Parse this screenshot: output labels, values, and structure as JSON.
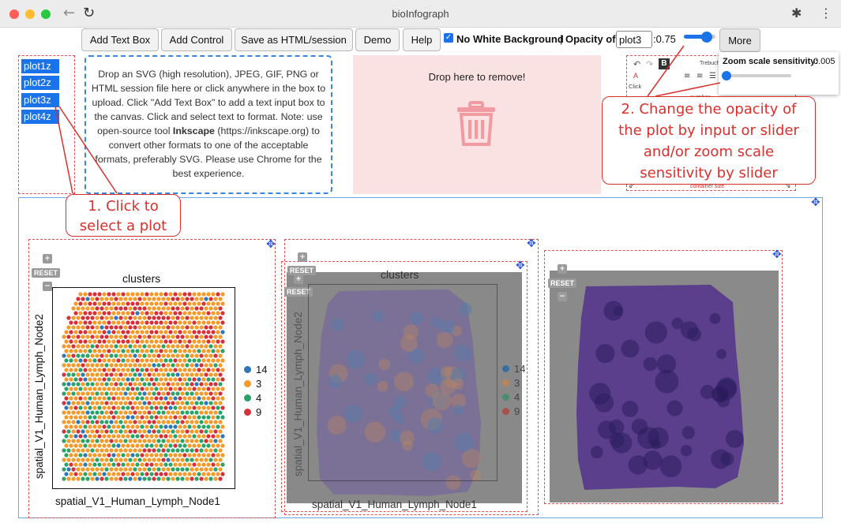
{
  "window": {
    "title": "bioInfograph"
  },
  "toolbar": {
    "buttons": [
      "Add Text Box",
      "Add Control",
      "Save as HTML/session",
      "Demo",
      "Help"
    ],
    "no_white_background_label": "No White Background",
    "separator": "|",
    "opacity_label": "Opacity of",
    "opacity_input_value": "plot3",
    "opacity_value": ":0.75",
    "opacity_fraction": 0.75,
    "more_label": "More"
  },
  "plot_list": [
    "plot1z",
    "plot2z",
    "plot3z",
    "plot4z"
  ],
  "dropzone": {
    "line1": "Drop an SVG (high resolution), JPEG, GIF, PNG or HTML session file here or click anywhere in the box to upload. Click \"Add Text Box\" to add a text input box to the canvas. Click and select text to format. Note: use open-source tool ",
    "tool_name": "Inkscape",
    "line2": " (https://inkscape.org) to convert other formats to one of the acceptable formats, preferably SVG. Please use Chrome for the best experience."
  },
  "remove_zone": {
    "label": "Drop here to remove!",
    "icon": "trash-icon"
  },
  "editor": {
    "undo_icon": "undo-icon",
    "redo_icon": "redo-icon",
    "bold_label": "B",
    "font_label": "Trebuch",
    "click_hint": "Click",
    "number_label": "number",
    "container_size_label": "container size"
  },
  "zoom_popup": {
    "label": "Zoom scale sensitivity:",
    "value": "0.005",
    "level": 0.0
  },
  "callouts": {
    "one": "1. Click to select a plot",
    "two": "2. Change the opacity of the plot by input or slider and/or zoom scale sensitivity by slider"
  },
  "plots": {
    "zoom_in": "+",
    "zoom_out": "−",
    "reset": "RESET",
    "clusters_title": "clusters",
    "xlabel": "spatial_V1_Human_Lymph_Node1",
    "ylabel": "spatial_V1_Human_Lymph_Node2",
    "legend": [
      {
        "name": "14",
        "color": "#2e78b8"
      },
      {
        "name": "3",
        "color": "#f39a2a"
      },
      {
        "name": "4",
        "color": "#2aa36a"
      },
      {
        "name": "9",
        "color": "#d6303a"
      }
    ]
  },
  "colors": {
    "accent": "#1a73e8",
    "annotation_red": "#d9302c",
    "tissue_purple": "#5b3e8c"
  }
}
